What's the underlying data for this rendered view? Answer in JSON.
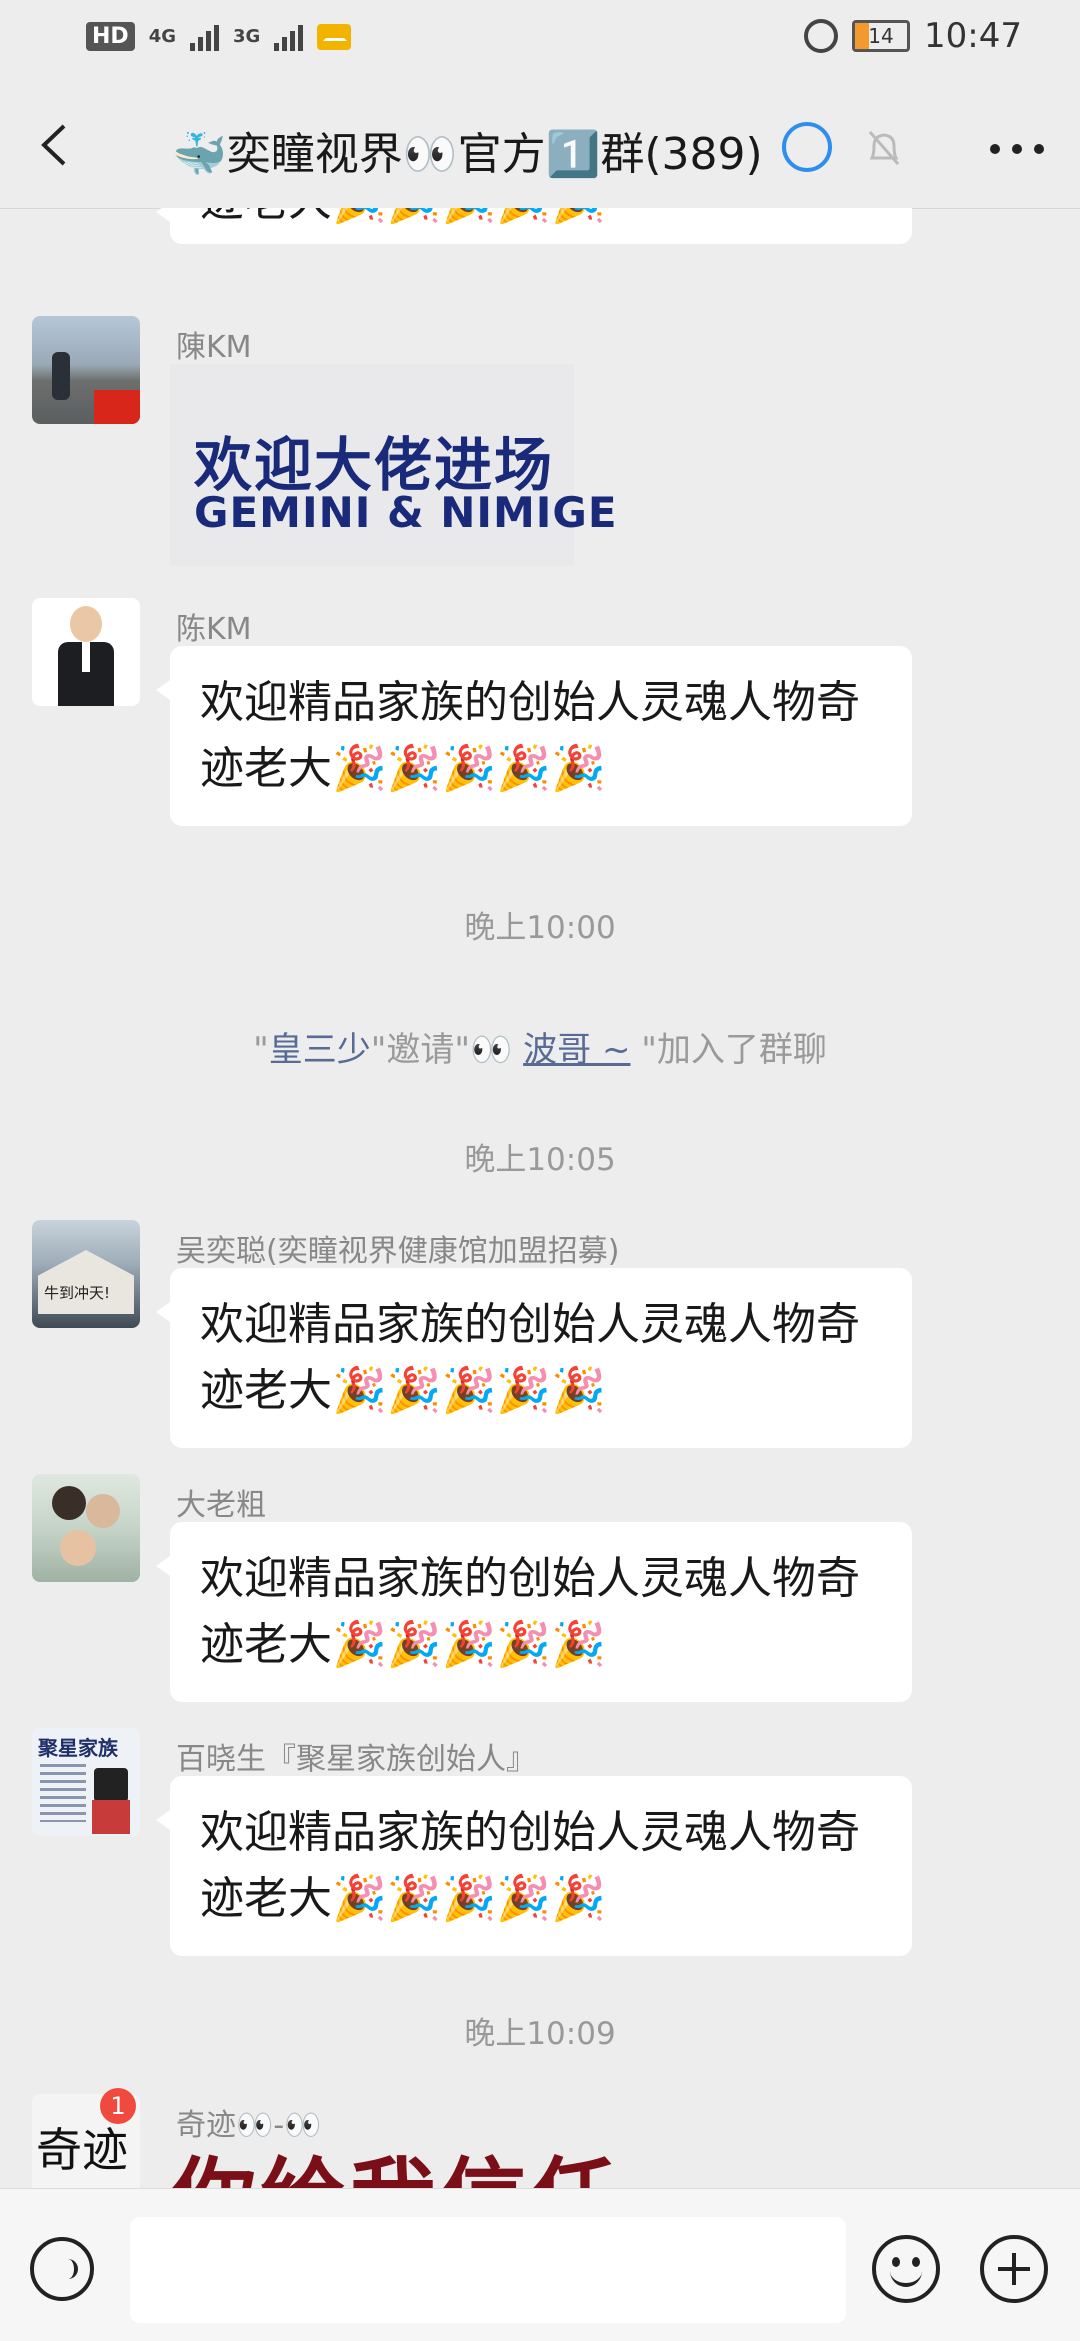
{
  "status_bar": {
    "hd": "HD",
    "net1": "4G",
    "net2": "3G",
    "battery": "14",
    "time": "10:47"
  },
  "header": {
    "title": "🐳奕瞳视界👀官方1️⃣群(389)"
  },
  "messages": [
    {
      "type": "text_partial",
      "text": "迹老大🎉🎉🎉🎉🎉"
    },
    {
      "type": "image",
      "sender": "陳KM",
      "image_line1": "欢迎大佬进场",
      "image_line2": "GEMINI & NIMIGE"
    },
    {
      "type": "text",
      "sender": "陈KM",
      "text": "欢迎精品家族的创始人灵魂人物奇迹老大🎉🎉🎉🎉🎉"
    },
    {
      "type": "time",
      "text": "晚上10:00"
    },
    {
      "type": "system",
      "inviter": "皇三少",
      "mid": "\"邀请\"👀 ",
      "invitee": "波哥 ~",
      "suffix": " \"加入了群聊"
    },
    {
      "type": "time",
      "text": "晚上10:05"
    },
    {
      "type": "text",
      "sender": "吴奕聪(奕瞳视界健康馆加盟招募)",
      "text": "欢迎精品家族的创始人灵魂人物奇迹老大🎉🎉🎉🎉🎉"
    },
    {
      "type": "text",
      "sender": "大老粗",
      "text": "欢迎精品家族的创始人灵魂人物奇迹老大🎉🎉🎉🎉🎉"
    },
    {
      "type": "text",
      "sender": "百晓生『聚星家族创始人』",
      "text": "欢迎精品家族的创始人灵魂人物奇迹老大🎉🎉🎉🎉🎉"
    },
    {
      "type": "time",
      "text": "晚上10:09"
    },
    {
      "type": "image_partial",
      "sender": "奇迹👀-👀",
      "image_text": "你给我信任",
      "badge": "1"
    }
  ],
  "avatars": {
    "a3_text": "牛到冲天!",
    "a5_text": "聚星家族",
    "a6_text": "奇迹"
  }
}
